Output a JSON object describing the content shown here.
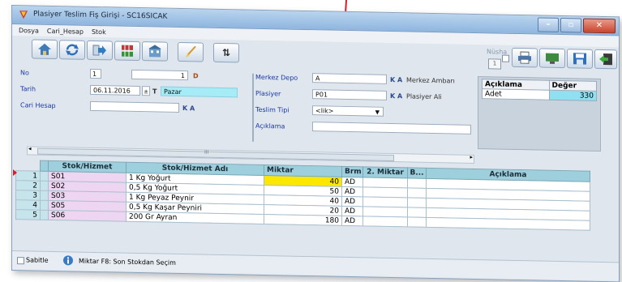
{
  "window": {
    "title": "Plasiyer Teslim Fiş Girişi - SC16SICAK"
  },
  "menu": [
    "Dosya",
    "Cari_Hesap",
    "Stok"
  ],
  "toolbar": {
    "icons": [
      "home-icon",
      "refresh-icon",
      "forward-icon",
      "grid-exchange-icon",
      "building-icon",
      "brush-icon",
      "sort-az-icon"
    ],
    "sort_label": "⇅"
  },
  "nusha": {
    "label": "Nüsha",
    "value": "1"
  },
  "form": {
    "no_label": "No",
    "no_box": "1",
    "no_value": "1",
    "no_d": "D",
    "tarih_label": "Tarih",
    "tarih_value": "06.11.2016",
    "tarih_t": "T",
    "day": "Pazar",
    "cari_label": "Cari Hesap",
    "ka": "K",
    "ka_a": "A",
    "merkez_label": "Merkez Depo",
    "merkez_value": "A",
    "merkez_desc": "Merkez Ambarı",
    "plasiyer_label": "Plasiyer",
    "plasiyer_value": "P01",
    "plasiyer_desc": "Plasiyer Ali",
    "teslim_label": "Teslim Tipi",
    "teslim_value": "<lik>",
    "aciklama_label": "Açıklama"
  },
  "props": {
    "headers": [
      "Açıklama",
      "Değer"
    ],
    "rows": [
      {
        "key": "Adet",
        "value": "330"
      }
    ]
  },
  "scroll_label": "III",
  "grid": {
    "headers": [
      "Stok/Hizmet",
      "Stok/Hizmet Adı",
      "Miktar",
      "Brm",
      "2. Miktar",
      "B...",
      "Açıklama"
    ],
    "rows": [
      {
        "idx": "1",
        "code": "S01",
        "name": "1 Kg Yoğurt",
        "qty": "40",
        "unit": "AD"
      },
      {
        "idx": "2",
        "code": "S02",
        "name": "0,5 Kg Yoğurt",
        "qty": "50",
        "unit": "AD"
      },
      {
        "idx": "3",
        "code": "S03",
        "name": "1 Kg Peyaz Peynir",
        "qty": "40",
        "unit": "AD"
      },
      {
        "idx": "4",
        "code": "S05",
        "name": "0,5 Kg Kaşar Peyniri",
        "qty": "20",
        "unit": "AD"
      },
      {
        "idx": "5",
        "code": "S06",
        "name": "200 Gr Ayran",
        "qty": "180",
        "unit": "AD"
      }
    ]
  },
  "status": {
    "sabitle": "Sabitle",
    "hint": "Miktar F8: Son Stokdan Seçim"
  },
  "colors": {
    "accent": "#d0202a",
    "header": "#9dd0dc",
    "highlight": "#fbe700"
  }
}
